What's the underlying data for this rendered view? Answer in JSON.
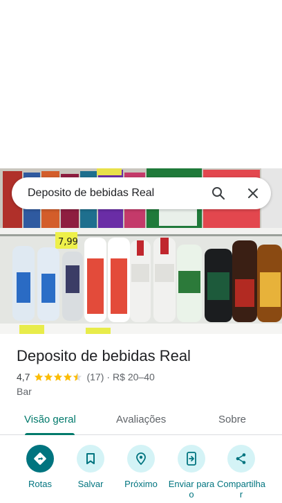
{
  "search": {
    "query": "Deposito de bebidas Real"
  },
  "photo": {
    "price_tag": "7,99"
  },
  "place": {
    "name": "Deposito de bebidas Real",
    "rating": "4,7",
    "stars": 4.5,
    "review_count": "(17)",
    "separator": "·",
    "price_range": "R$ 20–40",
    "category": "Bar"
  },
  "tabs": [
    {
      "label": "Visão geral",
      "active": true
    },
    {
      "label": "Avaliações",
      "active": false
    },
    {
      "label": "Sobre",
      "active": false
    }
  ],
  "actions": [
    {
      "label": "Rotas",
      "icon": "directions-icon"
    },
    {
      "label": "Salvar",
      "icon": "bookmark-icon"
    },
    {
      "label": "Próximo",
      "icon": "nearby-icon"
    },
    {
      "label": "Enviar para o",
      "icon": "send-to-phone-icon"
    },
    {
      "label": "Compartilha r",
      "icon": "share-icon"
    }
  ],
  "colors": {
    "accent": "#00747f",
    "star": "#fbbc04",
    "tab_active": "#00796b"
  }
}
